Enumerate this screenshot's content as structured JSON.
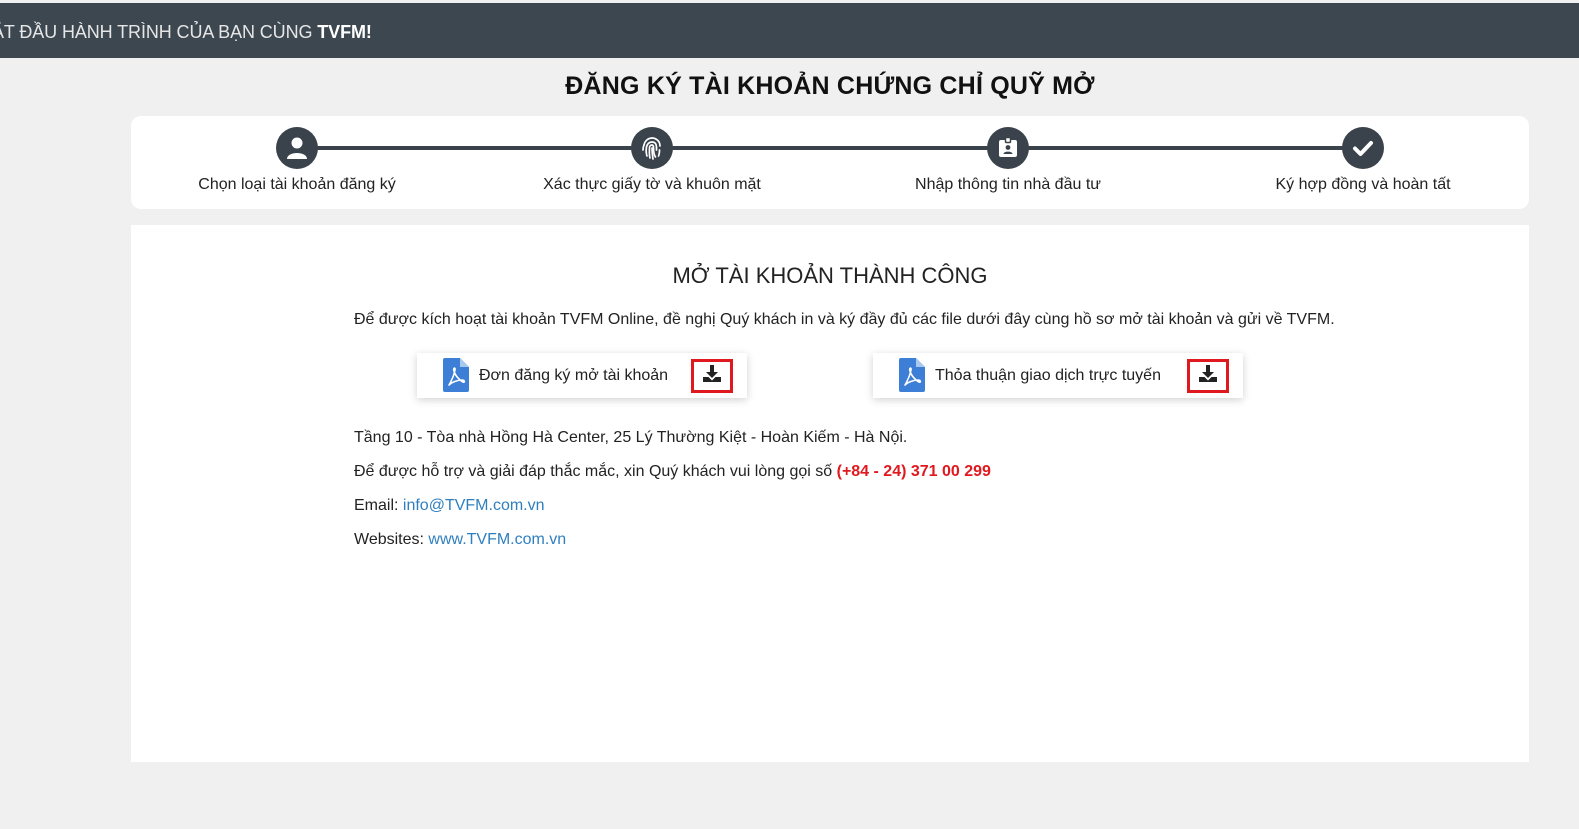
{
  "header": {
    "text": "ẮT ĐẦU HÀNH TRÌNH CỦA BẠN CÙNG ",
    "brand": "TVFM!"
  },
  "page_title": "ĐĂNG KÝ TÀI KHOẢN CHỨNG CHỈ QUỸ MỞ",
  "steps": [
    {
      "label": "Chọn loại tài khoản đăng ký",
      "icon": "user-icon"
    },
    {
      "label": "Xác thực giấy tờ và khuôn mặt",
      "icon": "fingerprint-icon"
    },
    {
      "label": "Nhập thông tin nhà đầu tư",
      "icon": "id-card-icon"
    },
    {
      "label": "Ký hợp đồng và hoàn tất",
      "icon": "check-icon"
    }
  ],
  "result": {
    "title": "MỞ TÀI KHOẢN THÀNH CÔNG",
    "intro": "Để được kích hoạt tài khoản TVFM Online, đề nghị Quý khách in và ký đầy đủ các file dưới đây cùng hồ sơ mở tài khoản và gửi về TVFM."
  },
  "files": [
    {
      "label": "Đơn đăng ký mở tài khoản",
      "icon": "pdf-icon",
      "action_icon": "download-icon"
    },
    {
      "label": "Thỏa thuận giao dịch trực tuyến",
      "icon": "pdf-icon",
      "action_icon": "download-icon"
    }
  ],
  "contact": {
    "address": "Tầng 10 - Tòa nhà Hồng Hà Center, 25 Lý Thường Kiệt - Hoàn Kiếm - Hà Nội.",
    "support_text": "Để được hỗ trợ và giải đáp thắc mắc, xin Quý khách vui lòng gọi số ",
    "phone": "(+84 - 24) 371 00 299",
    "email_label": "Email: ",
    "email": "info@TVFM.com.vn",
    "website_label": "Websites: ",
    "website": "www.TVFM.com.vn"
  },
  "colors": {
    "header_bg": "#3d4750",
    "step_dark": "#3a434c",
    "accent_red": "#e0191f",
    "link_blue": "#2f7fbf",
    "pdf_blue": "#3d7fd6"
  }
}
